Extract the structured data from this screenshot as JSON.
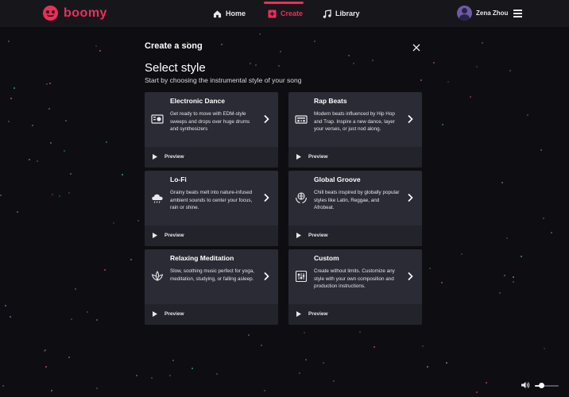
{
  "app": {
    "name": "boomy",
    "brand_color": "#ee2d5a"
  },
  "nav": {
    "home": "Home",
    "create": "Create",
    "library": "Library",
    "active": "create"
  },
  "user": {
    "name": "Zena Zhou"
  },
  "dialog": {
    "title": "Create a song",
    "heading": "Select style",
    "subheading": "Start by choosing the instrumental style of your song"
  },
  "styles": [
    {
      "title": "Electronic Dance",
      "description": "Get ready to move with EDM-style sweeps and drops over huge drums and synthesizers",
      "preview": "Preview",
      "icon": "speaker-icon"
    },
    {
      "title": "Rap Beats",
      "description": "Modern beats influenced by Hip Hop and Trap. Inspire a new dance, layer your verses, or just nod along.",
      "preview": "Preview",
      "icon": "boombox-icon"
    },
    {
      "title": "Lo-Fi",
      "description": "Grainy beats melt into nature-infused ambient sounds to center your focus, rain or shine.",
      "preview": "Preview",
      "icon": "rain-cloud-icon"
    },
    {
      "title": "Global Groove",
      "description": "Chill beats inspired by globally popular styles like Latin, Reggae, and Afrobeat.",
      "preview": "Preview",
      "icon": "globe-hands-icon"
    },
    {
      "title": "Relaxing Meditation",
      "description": "Slow, soothing music perfect for yoga, meditation, studying, or falling asleep.",
      "preview": "Preview",
      "icon": "lotus-icon"
    },
    {
      "title": "Custom",
      "description": "Create without limits. Customize any style with your own composition and production instructions.",
      "preview": "Preview",
      "icon": "sliders-icon"
    }
  ],
  "player": {
    "volume": 0.25
  }
}
